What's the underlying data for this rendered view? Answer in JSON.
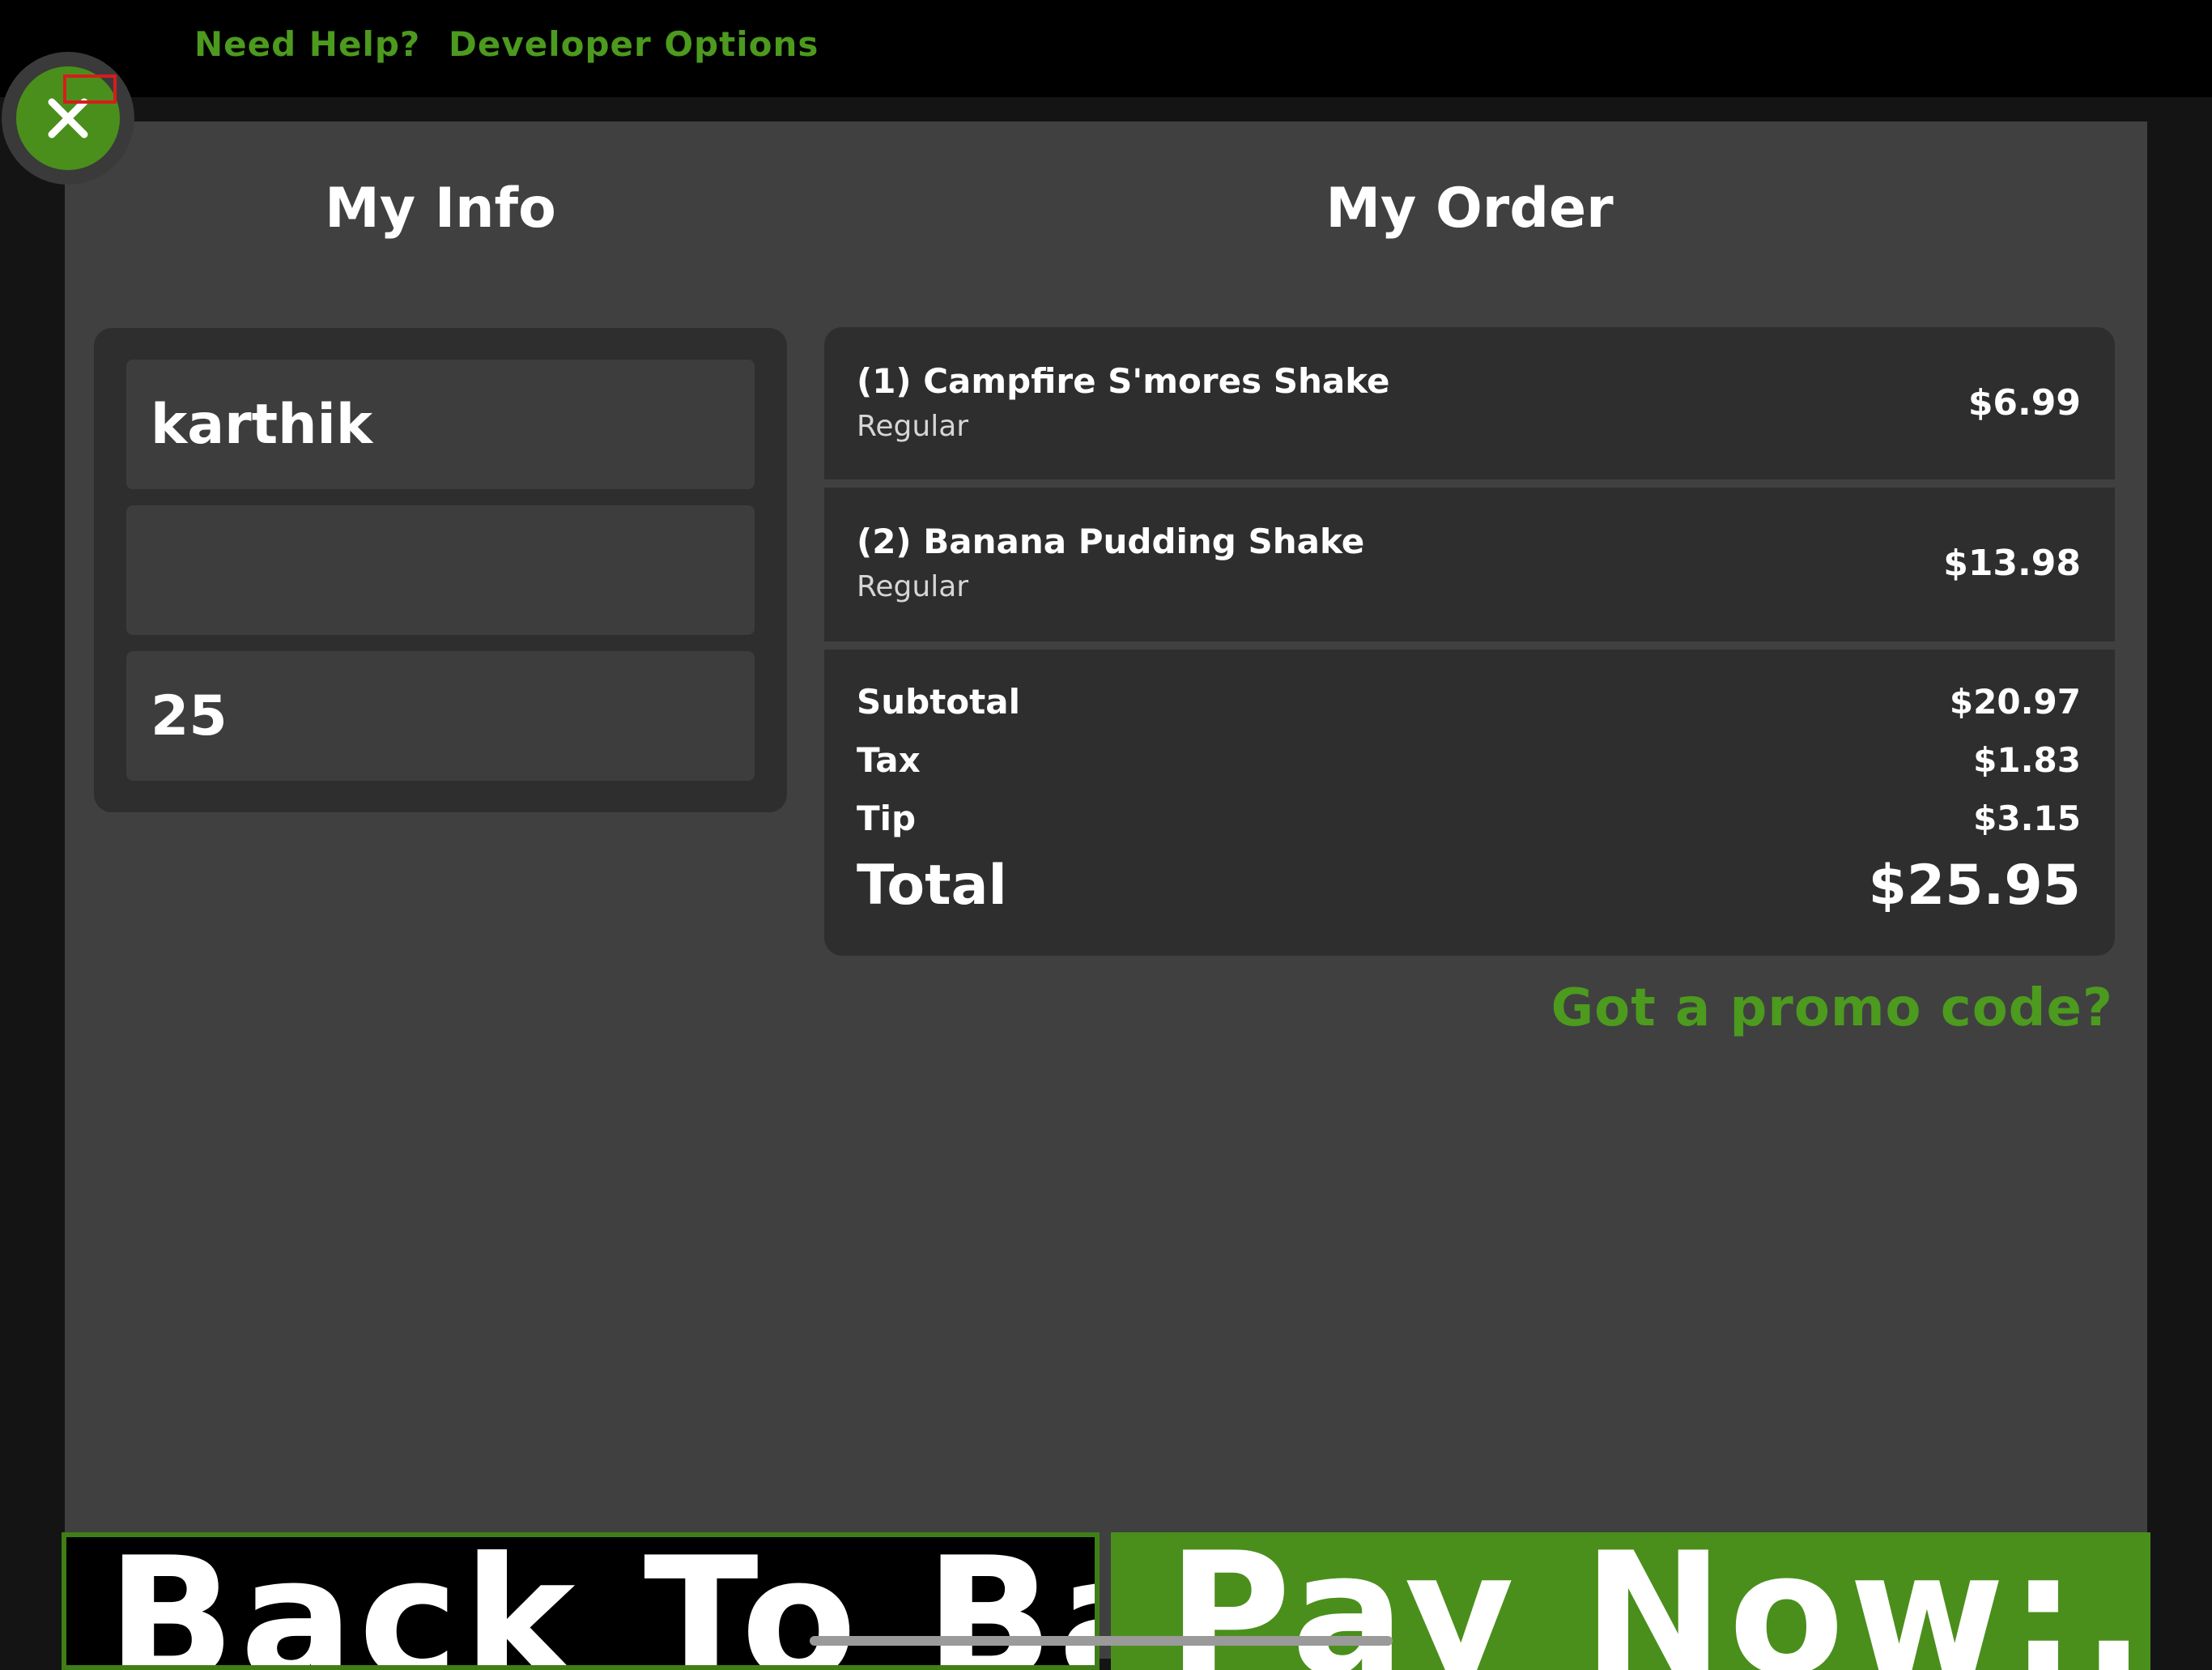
{
  "topbar": {
    "help_link": "Need Help?",
    "developer_link": "Developer Options"
  },
  "info": {
    "heading": "My Info",
    "name_value": "karthik",
    "second_value": "",
    "third_value": "25"
  },
  "order": {
    "heading": "My Order",
    "items": [
      {
        "name": "(1) Campfire S'mores Shake",
        "size": "Regular",
        "price": "$6.99"
      },
      {
        "name": "(2) Banana Pudding Shake",
        "size": "Regular",
        "price": "$13.98"
      }
    ],
    "subtotal_label": "Subtotal",
    "subtotal_value": "$20.97",
    "tax_label": "Tax",
    "tax_value": "$1.83",
    "tip_label": "Tip",
    "tip_value": "$3.15",
    "total_label": "Total",
    "total_value": "$25.95",
    "promo_link": "Got a promo code?"
  },
  "actions": {
    "back_label": "Back To Bag",
    "pay_label": "Pay Now:..."
  },
  "colors": {
    "accent_green": "#4c9a1e",
    "button_green": "#4a8f1c",
    "panel_gray": "#404040",
    "card_gray": "#2e2e2e"
  },
  "icons": {
    "close": "close-icon"
  }
}
